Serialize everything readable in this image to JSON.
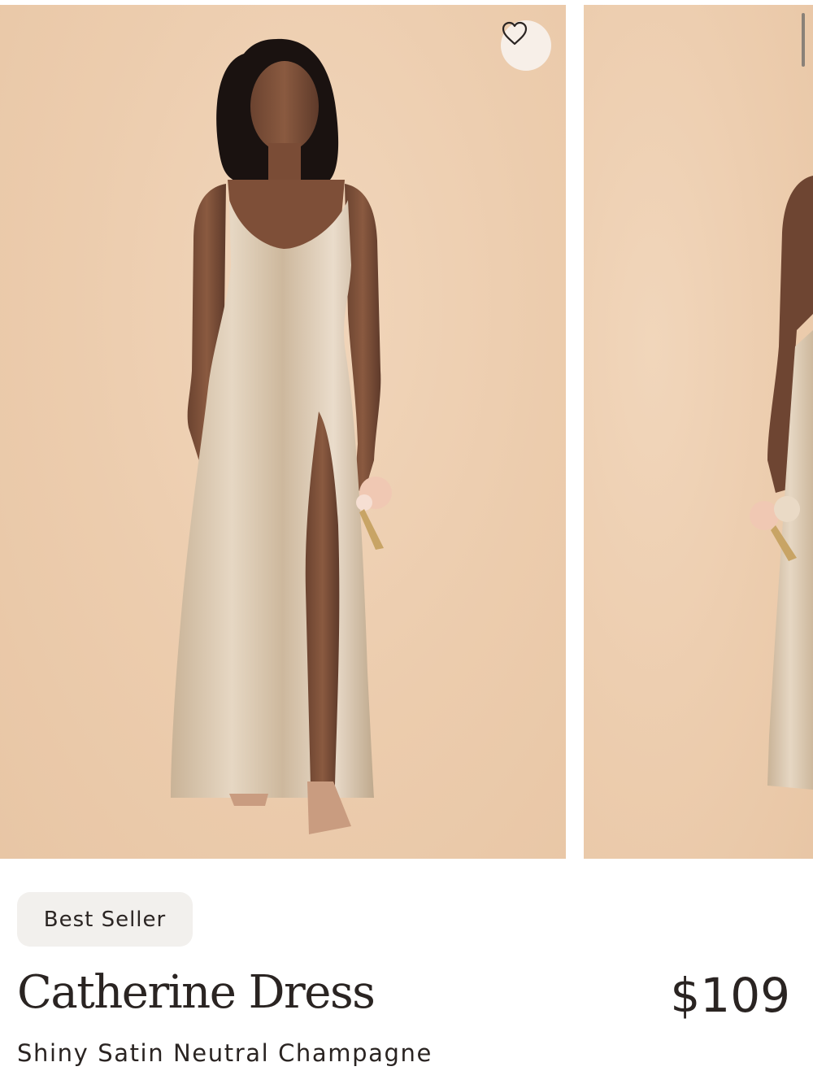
{
  "gallery": {
    "main_image_alt": "",
    "next_image_alt": ""
  },
  "product": {
    "badge": "Best Seller",
    "name": "Catherine Dress",
    "price": "$109",
    "variant": "Shiny Satin Neutral Champagne"
  },
  "icons": {
    "favorite": "heart-outline-icon"
  },
  "colors": {
    "photo_background": "#efd0b2",
    "dress": "#d9c6ad",
    "text": "#2a2422",
    "badge_background": "#f2f0ed"
  }
}
